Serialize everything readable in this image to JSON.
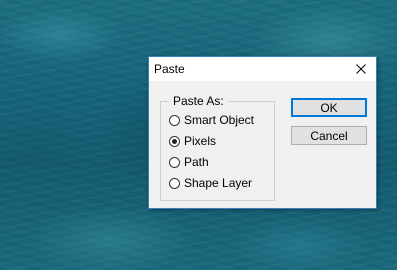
{
  "dialog": {
    "title": "Paste",
    "close_icon": "close-icon",
    "group_label": "Paste As:",
    "options": [
      {
        "label": "Smart Object",
        "selected": false
      },
      {
        "label": "Pixels",
        "selected": true
      },
      {
        "label": "Path",
        "selected": false
      },
      {
        "label": "Shape Layer",
        "selected": false
      }
    ],
    "ok_label": "OK",
    "cancel_label": "Cancel"
  },
  "colors": {
    "titlebar_border": "#3b7fb6",
    "default_button_border": "#0078d7",
    "background_water": "#16647a"
  }
}
